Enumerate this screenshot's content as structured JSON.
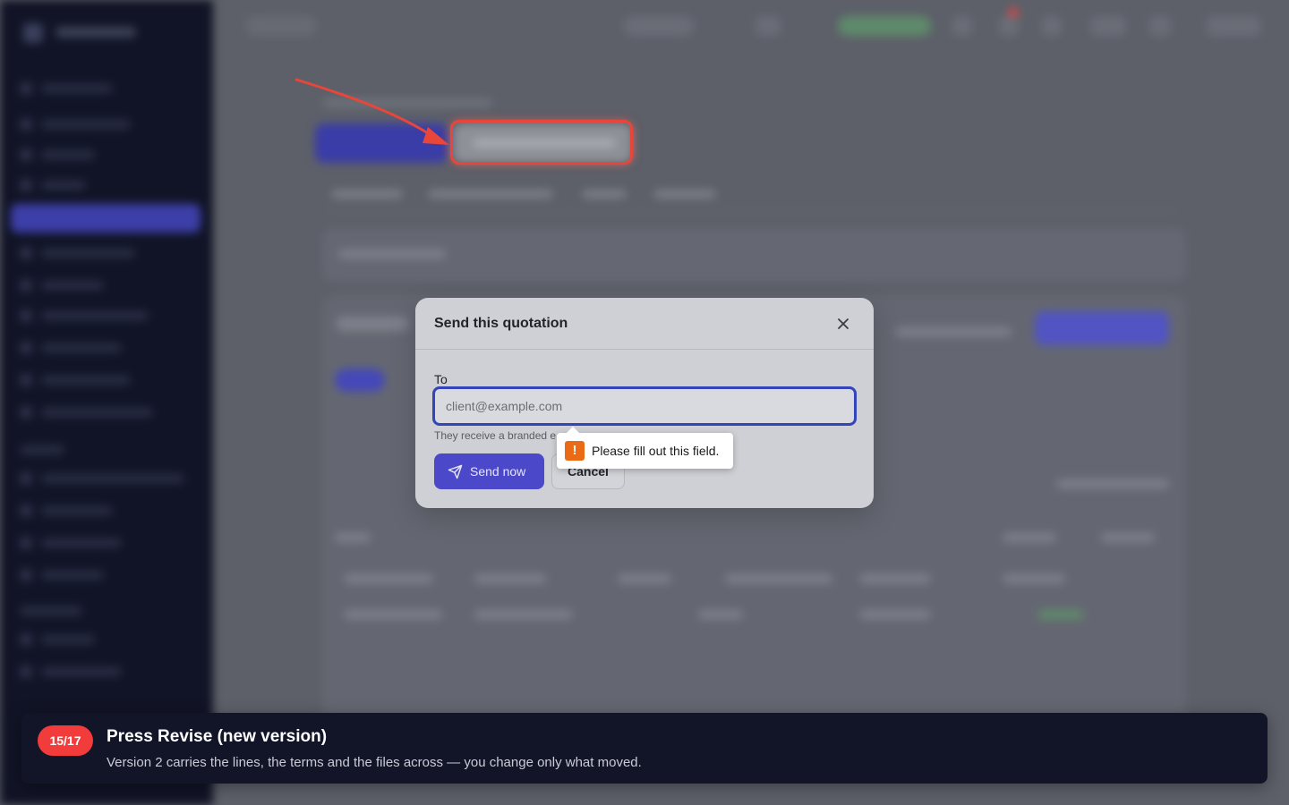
{
  "dialog": {
    "title": "Send this quotation",
    "to_label": "To",
    "email_placeholder": "client@example.com",
    "email_value": "",
    "hint": "They receive a branded e",
    "send_label": "Send now",
    "cancel_label": "Cancel",
    "validation_message": "Please fill out this field."
  },
  "tour": {
    "step": "15/17",
    "title": "Press Revise (new version)",
    "description": "Version 2 carries the lines, the terms and the files across — you change only what moved."
  },
  "colors": {
    "accent": "#4b48c9",
    "highlight": "#e8463b",
    "warning": "#ea6a15",
    "banner_bg": "#121528"
  },
  "icons": {
    "close": "close-icon",
    "send": "paper-plane-icon",
    "warning": "exclamation-icon"
  }
}
